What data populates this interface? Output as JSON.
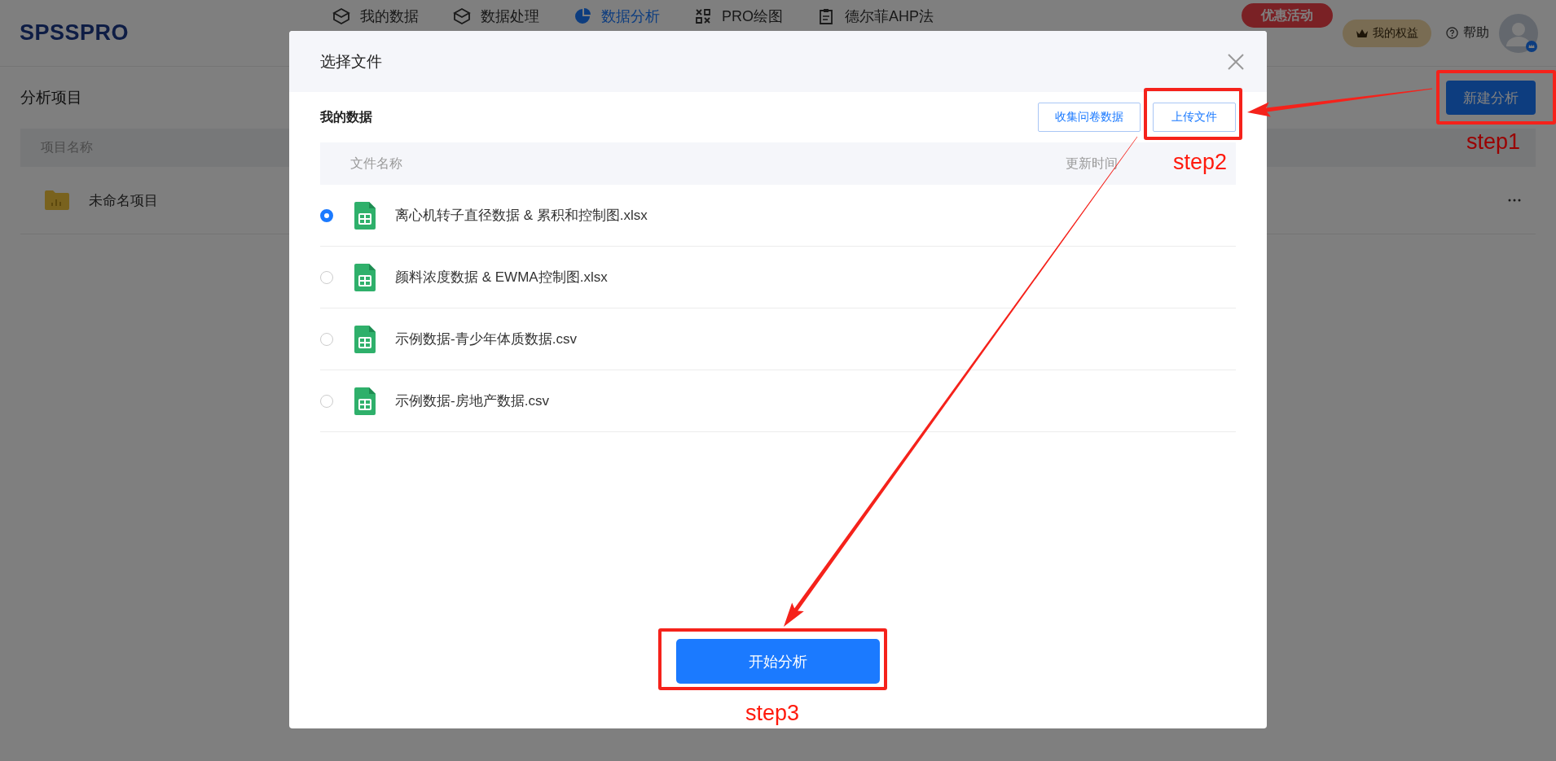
{
  "header": {
    "logo": "SPSSPRO",
    "nav": [
      {
        "label": "我的数据",
        "selected": false
      },
      {
        "label": "数据处理",
        "selected": false
      },
      {
        "label": "数据分析",
        "selected": true
      },
      {
        "label": "PRO绘图",
        "selected": false
      },
      {
        "label": "德尔菲AHP法",
        "selected": false
      }
    ],
    "promo_button": "优惠活动",
    "benefits_button": "我的权益",
    "help": "帮助"
  },
  "page": {
    "title": "分析项目",
    "new_button": "新建分析",
    "table": {
      "columns": [
        "项目名称"
      ],
      "rows": [
        {
          "name": "未命名项目"
        }
      ]
    }
  },
  "dialog": {
    "title": "选择文件",
    "section_title": "我的数据",
    "buttons": [
      "收集问卷数据",
      "上传文件"
    ],
    "table": {
      "columns": [
        "文件名称",
        "更新时间"
      ],
      "rows": [
        {
          "name": "离心机转子直径数据 & 累积和控制图.xlsx",
          "selected": true
        },
        {
          "name": "颜料浓度数据 & EWMA控制图.xlsx",
          "selected": false
        },
        {
          "name": "示例数据-青少年体质数据.csv",
          "selected": false
        },
        {
          "name": "示例数据-房地产数据.csv",
          "selected": false
        }
      ]
    },
    "primary_button": "开始分析"
  },
  "annotations": [
    {
      "text": "step1"
    },
    {
      "text": "step2"
    },
    {
      "text": "step3"
    }
  ]
}
